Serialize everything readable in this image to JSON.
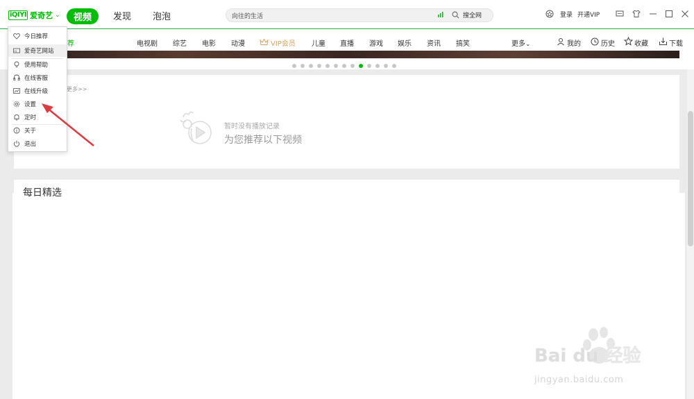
{
  "app": {
    "logo_text": "爱奇艺"
  },
  "title_tabs": [
    {
      "label": "视频",
      "active": true
    },
    {
      "label": "发现",
      "active": false
    },
    {
      "label": "泡泡",
      "active": false
    }
  ],
  "search": {
    "value": "向往的生活",
    "button": "搜全网"
  },
  "titlebar_right": {
    "login": "登录",
    "vip": "开通VIP"
  },
  "categories": [
    "电视剧",
    "综艺",
    "电影",
    "动漫",
    "VIP会员",
    "儿童",
    "直播",
    "游戏",
    "娱乐",
    "资讯",
    "搞笑",
    "更多"
  ],
  "category_peek": "荐",
  "user_links": {
    "mine": "我的",
    "history": "历史",
    "favorites": "收藏",
    "download": "下载"
  },
  "carousel": {
    "dot_count": 13,
    "active_index": 8
  },
  "history_card": {
    "more": "更多>>",
    "empty_line1": "暂时没有播放记录",
    "empty_line2": "为您推荐以下视频"
  },
  "daily": {
    "title": "每日精选"
  },
  "dropdown": {
    "items": [
      {
        "label": "今日推荐",
        "icon": "heart-icon"
      },
      {
        "label": "爱奇艺网站",
        "icon": "website-icon"
      },
      {
        "label": "使用帮助",
        "icon": "lightbulb-icon"
      },
      {
        "label": "在线客服",
        "icon": "headset-icon"
      },
      {
        "label": "在线升级",
        "icon": "upgrade-icon"
      },
      {
        "label": "设置",
        "icon": "gear-icon"
      },
      {
        "label": "定时",
        "icon": "bell-icon"
      },
      {
        "label": "关于",
        "icon": "info-icon"
      },
      {
        "label": "退出",
        "icon": "power-icon"
      }
    ]
  },
  "watermark": {
    "brand": "Bai du 经验",
    "url": "jingyan.baidu.com"
  },
  "colors": {
    "accent": "#00be06",
    "vip": "#d9a35b",
    "arrow": "#e0393e"
  }
}
